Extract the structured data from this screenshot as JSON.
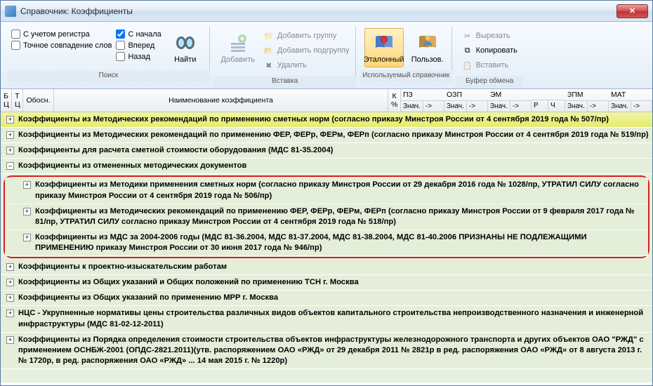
{
  "window": {
    "title": "Справочник: Коэффициенты"
  },
  "ribbon": {
    "search": {
      "label": "Поиск",
      "chk1": "С учетом регистра",
      "chk2": "Точное совпадение слов",
      "chk3": "С начала",
      "chk4": "Вперед",
      "chk5": "Назад",
      "find": "Найти"
    },
    "insert": {
      "label": "Вставка",
      "add": "Добавить",
      "add_group": "Добавить группу",
      "add_sub": "Добавить подгруппу",
      "del": "Удалить"
    },
    "dir": {
      "label": "Используемый справочник",
      "ref": "Эталонный",
      "usr": "Пользов."
    },
    "clip": {
      "label": "Буфер обмена",
      "cut": "Вырезать",
      "copy": "Копировать",
      "paste": "Вставить"
    }
  },
  "cols": {
    "bc": "Б\nЦ",
    "tc": "Т\nЦ",
    "obos": "Обосн.",
    "name": "Наименование коэффициента",
    "kpc": "К\n%",
    "pz": "ПЗ",
    "ozp": "ОЗП",
    "em": "ЭМ",
    "zpm": "ЗПМ",
    "mat": "МАТ",
    "znach": "Знач.",
    "arrow": "->",
    "r": "Р",
    "ch": "Ч"
  },
  "rows": {
    "r1": "Коэффициенты из Методических рекомендаций по применению сметных норм (согласно приказу Минстроя России от 4 сентября 2019 года № 507/пр)",
    "r2": "Коэффициенты из Методических рекомендаций по применению ФЕР, ФЕРр, ФЕРм, ФЕРп (согласно приказу Минстроя России от 4 сентября 2019 года № 519/пр)",
    "r3": "Коэффициенты для расчета сметной стоимости оборудования (МДС 81-35.2004)",
    "r4": "Коэффициенты из отмененных методических документов",
    "r4a": "Коэффициенты из Методики применения сметных норм (согласно приказу Минстроя России от 29 декабря 2016 года № 1028/пр, УТРАТИЛ СИЛУ согласно приказу Минстроя России от 4 сентября 2019 года № 506/пр)",
    "r4b": "Коэффициенты из Методических рекомендаций по применению ФЕР, ФЕРр, ФЕРм, ФЕРп (согласно приказу Минстроя России от 9 февраля 2017 года № 81/пр, УТРАТИЛ СИЛУ согласно приказу Минстроя России от 4 сентября 2019 года № 518/пр)",
    "r4c": "Коэффициенты из МДС за 2004-2006 годы (МДС 81-36.2004, МДС 81-37.2004, МДС 81-38.2004, МДС 81-40.2006 ПРИЗНАНЫ НЕ ПОДЛЕЖАЩИМИ ПРИМЕНЕНИЮ приказу Минстроя России от 30 июня 2017 года № 946/пр)",
    "r5": "Коэффициенты к проектно-изыскательским работам",
    "r6": "Коэффициенты из Общих указаний и Общих положений по применению ТСН г. Москва",
    "r7": "Коэффициенты из Общих указаний по применению МРР г. Москва",
    "r8": "НЦС - Укрупненные нормативы цены строительства различных видов объектов капитального строительства непроизводственного назначения и инженерной инфраструктуры (МДС 81-02-12-2011)",
    "r9": "Коэффициенты из Порядка определения стоимости строительства объектов инфраструктуры железнодорожного транспорта и других объектов ОАО \"РЖД\" с применением ОСНБЖ-2001 (ОПДС-2821.2011)(утв. распоряжением ОАО «РЖД» от 29 декабря 2011 № 2821р в ред. распоряжения ОАО «РЖД» от 8 августа 2013 г. № 1720р, в ред. распоряжения ОАО «РЖД» ... 14 мая 2015 г. № 1220р)"
  }
}
